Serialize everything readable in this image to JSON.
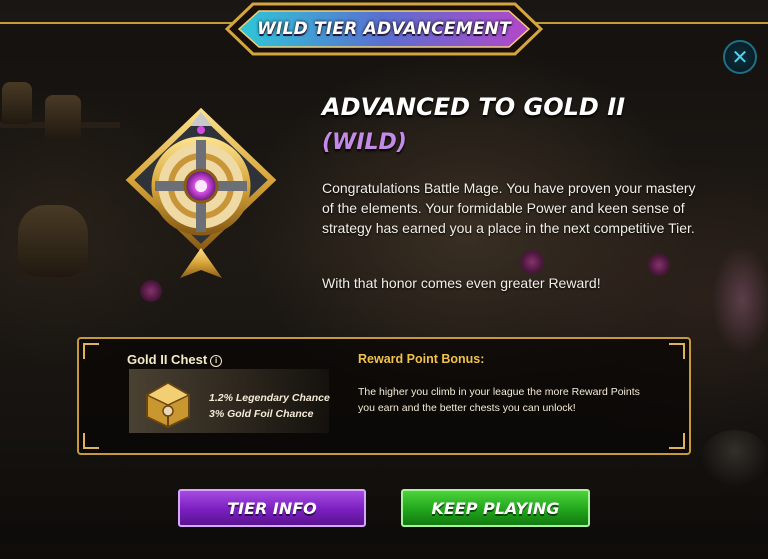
{
  "banner": {
    "title": "WILD TIER ADVANCEMENT"
  },
  "close": {
    "symbol": "✕"
  },
  "main": {
    "heading": "ADVANCED TO GOLD II",
    "subheading": "(WILD)",
    "paragraph1": "Congratulations Battle Mage. You have proven your mastery of the elements. Your formidable Power and keen sense of strategy has earned you a place in the next competitive Tier.",
    "paragraph2": "With that honor comes even greater Reward!"
  },
  "reward": {
    "chest_title": "Gold II Chest",
    "info_symbol": "i",
    "legendary_chance": "1.2% Legendary Chance",
    "gold_foil_chance": "3% Gold Foil Chance",
    "bonus_title": "Reward Point Bonus:",
    "bonus_text": "The higher you climb in your league the more Reward Points you earn and the better chests you can unlock!"
  },
  "buttons": {
    "tier_info": "TIER INFO",
    "keep_playing": "KEEP PLAYING"
  },
  "colors": {
    "gold_border": "#c69a3b",
    "subheading_purple": "#c58ae8",
    "bonus_gold": "#f1c24b",
    "tier_button": "#7a1fc0",
    "keep_button": "#22a51c"
  },
  "icons": {
    "tier_emblem": "gold-tier-emblem-icon",
    "chest": "gold-chest-icon",
    "close": "close-icon",
    "info": "info-icon"
  }
}
